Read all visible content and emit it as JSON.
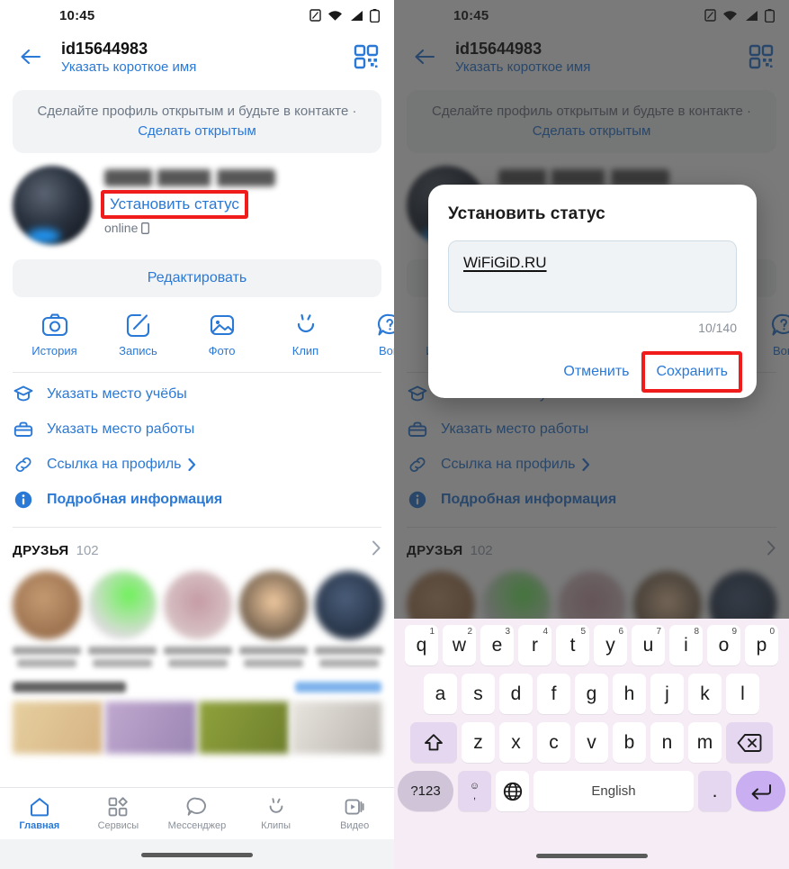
{
  "status_bar": {
    "time": "10:45",
    "icons": [
      "nfc-icon",
      "wifi-icon",
      "signal-icon",
      "battery-icon"
    ]
  },
  "header": {
    "back_icon": "back-arrow-icon",
    "title": "id15644983",
    "subtitle": "Указать короткое имя",
    "qr_icon": "qr-code-icon"
  },
  "promo": {
    "text": "Сделайте профиль открытым и будьте в контакте · ",
    "link": "Сделать открытым"
  },
  "profile": {
    "set_status_label": "Установить статус",
    "online_label": "online",
    "online_device_icon": "mobile-icon",
    "edit_label": "Редактировать"
  },
  "actions": [
    {
      "label": "История",
      "icon": "camera-icon"
    },
    {
      "label": "Запись",
      "icon": "pencil-square-icon"
    },
    {
      "label": "Фото",
      "icon": "image-icon"
    },
    {
      "label": "Клип",
      "icon": "clip-smile-icon"
    },
    {
      "label": "Воп",
      "icon": "question-bubble-icon"
    }
  ],
  "info_list": [
    {
      "label": "Указать место учёбы",
      "icon": "graduation-cap-icon",
      "chevron": false,
      "bold": false
    },
    {
      "label": "Указать место работы",
      "icon": "briefcase-icon",
      "chevron": false,
      "bold": false
    },
    {
      "label": "Ссылка на профиль",
      "icon": "link-icon",
      "chevron": true,
      "bold": false
    },
    {
      "label": "Подробная информация",
      "icon": "info-circle-icon",
      "chevron": false,
      "bold": true
    }
  ],
  "friends": {
    "title": "ДРУЗЬЯ",
    "count": "102",
    "chevron_icon": "chevron-right-icon",
    "items": [
      {
        "avatar_color": "#b08968"
      },
      {
        "avatar_color": "#8fe36b"
      },
      {
        "avatar_color": "#c3a0a8"
      },
      {
        "avatar_color": "#e8c9a0"
      },
      {
        "avatar_color": "#3b4a63"
      }
    ]
  },
  "photos": {
    "tiles": [
      "#e3c89a",
      "#b8a5c9",
      "#8a9c3e",
      "#dedad4"
    ]
  },
  "bottom_nav": {
    "items": [
      {
        "label": "Главная",
        "icon": "home-icon",
        "active": true
      },
      {
        "label": "Сервисы",
        "icon": "apps-grid-icon",
        "active": false
      },
      {
        "label": "Мессенджер",
        "icon": "chat-bubble-icon",
        "active": false
      },
      {
        "label": "Клипы",
        "icon": "clip-smile-icon",
        "active": false
      },
      {
        "label": "Видео",
        "icon": "video-play-icon",
        "active": false
      }
    ]
  },
  "dialog": {
    "title": "Установить статус",
    "input_value": "WiFiGiD.RU",
    "counter": "10/140",
    "cancel_label": "Отменить",
    "save_label": "Сохранить"
  },
  "keyboard": {
    "row1": [
      {
        "key": "q",
        "alt": "1"
      },
      {
        "key": "w",
        "alt": "2"
      },
      {
        "key": "e",
        "alt": "3"
      },
      {
        "key": "r",
        "alt": "4"
      },
      {
        "key": "t",
        "alt": "5"
      },
      {
        "key": "y",
        "alt": "6"
      },
      {
        "key": "u",
        "alt": "7"
      },
      {
        "key": "i",
        "alt": "8"
      },
      {
        "key": "o",
        "alt": "9"
      },
      {
        "key": "p",
        "alt": "0"
      }
    ],
    "row2": [
      "a",
      "s",
      "d",
      "f",
      "g",
      "h",
      "j",
      "k",
      "l"
    ],
    "row3": [
      "z",
      "x",
      "c",
      "v",
      "b",
      "n",
      "m"
    ],
    "shift_icon": "shift-up-arrow-icon",
    "backspace_icon": "backspace-icon",
    "symbols_label": "?123",
    "emoji_top": "☺",
    "emoji_bottom": ",",
    "globe_icon": "globe-icon",
    "space_label": "English",
    "period_label": ".",
    "enter_icon": "enter-return-icon"
  },
  "highlight_color": "#f01b1b",
  "accent_color": "#2a79d6"
}
